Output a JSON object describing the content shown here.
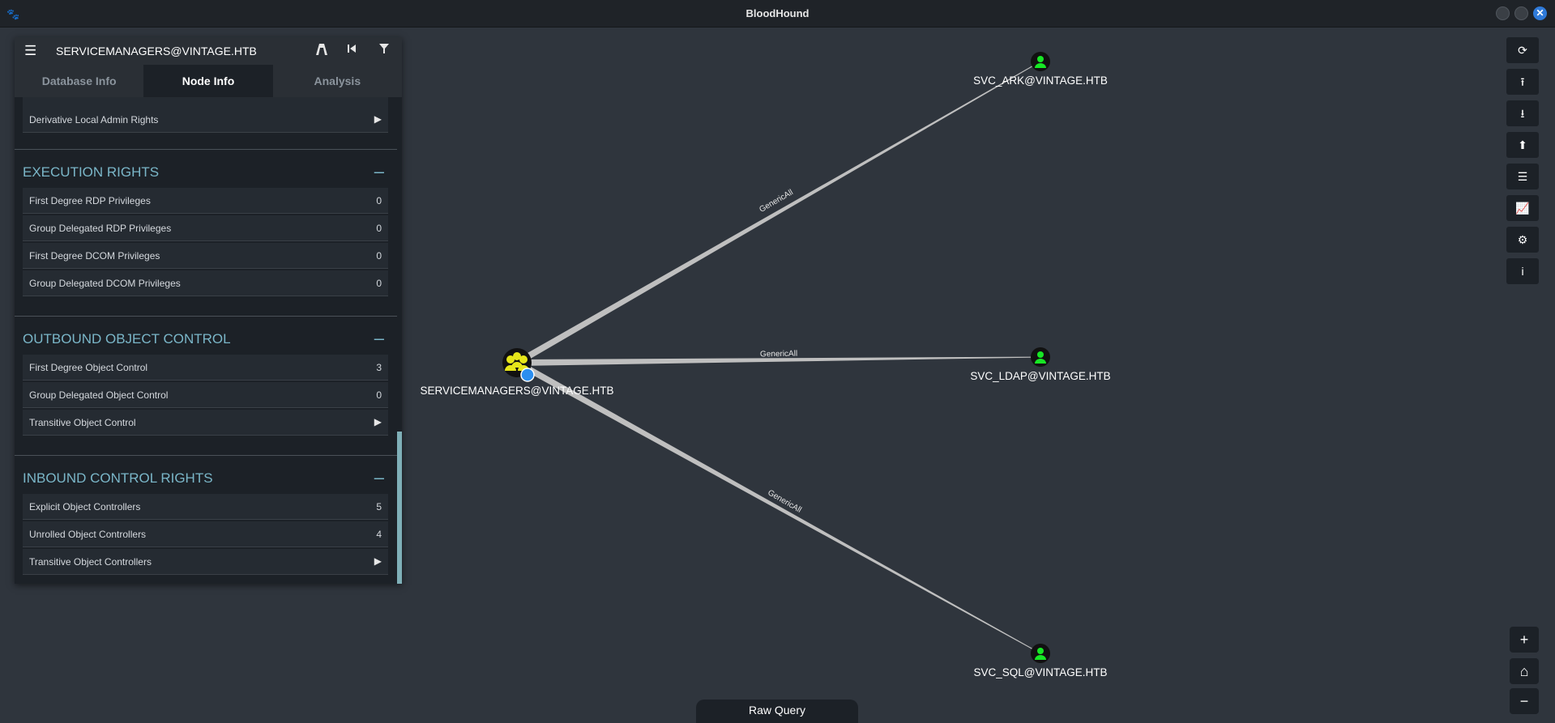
{
  "window": {
    "title": "BloodHound",
    "close_glyph": "✕"
  },
  "panel": {
    "node_title": "SERVICEMANAGERS@VINTAGE.HTB",
    "tabs": [
      {
        "label": "Database Info"
      },
      {
        "label": "Node Info"
      },
      {
        "label": "Analysis"
      }
    ],
    "partial_row": {
      "label": "Derivative Local Admin Rights"
    },
    "sections": [
      {
        "title": "EXECUTION RIGHTS",
        "rows": [
          {
            "label": "First Degree RDP Privileges",
            "value": "0"
          },
          {
            "label": "Group Delegated RDP Privileges",
            "value": "0"
          },
          {
            "label": "First Degree DCOM Privileges",
            "value": "0"
          },
          {
            "label": "Group Delegated DCOM Privileges",
            "value": "0"
          }
        ]
      },
      {
        "title": "OUTBOUND OBJECT CONTROL",
        "rows": [
          {
            "label": "First Degree Object Control",
            "value": "3"
          },
          {
            "label": "Group Delegated Object Control",
            "value": "0"
          },
          {
            "label": "Transitive Object Control",
            "value": "▶"
          }
        ]
      },
      {
        "title": "INBOUND CONTROL RIGHTS",
        "rows": [
          {
            "label": "Explicit Object Controllers",
            "value": "5"
          },
          {
            "label": "Unrolled Object Controllers",
            "value": "4"
          },
          {
            "label": "Transitive Object Controllers",
            "value": "▶"
          }
        ]
      }
    ]
  },
  "graph": {
    "nodes": [
      {
        "label": "SERVICEMANAGERS@VINTAGE.HTB",
        "type": "group"
      },
      {
        "label": "SVC_ARK@VINTAGE.HTB",
        "type": "user"
      },
      {
        "label": "SVC_LDAP@VINTAGE.HTB",
        "type": "user"
      },
      {
        "label": "SVC_SQL@VINTAGE.HTB",
        "type": "user"
      }
    ],
    "edges": [
      {
        "label": "GenericAll"
      },
      {
        "label": "GenericAll"
      },
      {
        "label": "GenericAll"
      }
    ],
    "colors": {
      "group": "#e6e61a",
      "user": "#17e625",
      "edge": "#bfbfbf",
      "pin": "#2b8ef0"
    }
  },
  "toolbar": [
    "refresh-icon",
    "upload-icon",
    "download-icon",
    "import-icon",
    "queries-icon",
    "stats-icon",
    "settings-icon",
    "info-icon"
  ],
  "zoom": {
    "in": "+",
    "home": "⌂",
    "out": "−"
  },
  "raw_query": {
    "label": "Raw Query"
  }
}
